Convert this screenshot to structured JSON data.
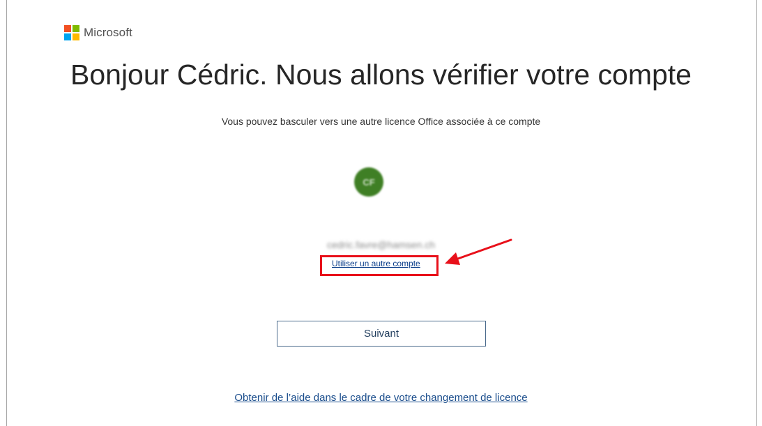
{
  "brand": {
    "name": "Microsoft",
    "logo_colors": [
      "#f25022",
      "#7fba00",
      "#00a4ef",
      "#ffb900"
    ]
  },
  "header": {
    "title": "Bonjour Cédric. Nous allons vérifier votre compte"
  },
  "main": {
    "subtitle": "Vous pouvez basculer vers une autre licence Office associée à ce compte",
    "account": {
      "avatar_initials": "CF",
      "email": "cedric.favre@hamsen.ch"
    },
    "switch_account_label": "Utiliser un autre compte",
    "next_button_label": "Suivant",
    "help_link_label": "Obtenir de l’aide dans le cadre de votre changement de licence"
  },
  "annotation": {
    "highlight_color": "#e8101a",
    "arrow_icon": "red-arrow-icon"
  }
}
